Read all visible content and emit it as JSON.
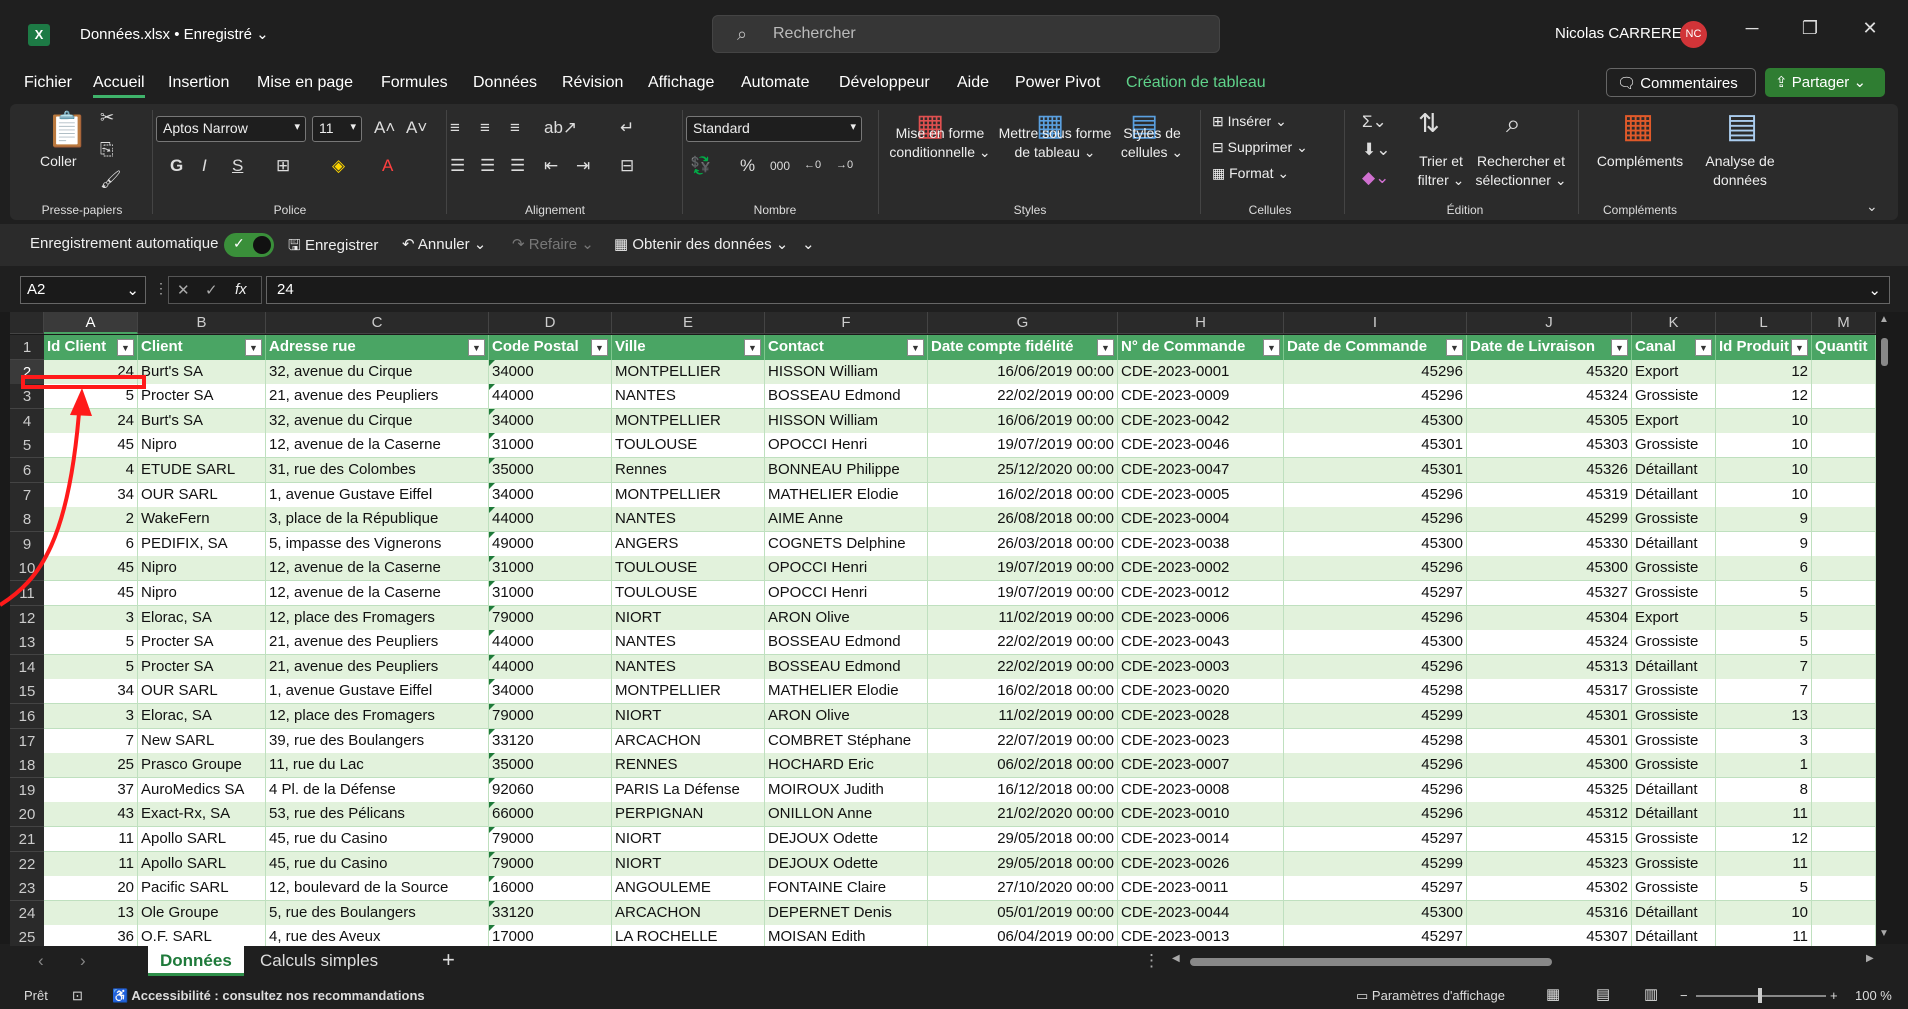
{
  "title": {
    "app_icon": "excel-logo",
    "doc": "Données.xlsx • Enregistré",
    "chev": "⌄",
    "search_placeholder": "Rechercher",
    "user": "Nicolas CARRERE",
    "initials": "NC"
  },
  "menu": [
    "Fichier",
    "Accueil",
    "Insertion",
    "Mise en page",
    "Formules",
    "Données",
    "Révision",
    "Affichage",
    "Automate",
    "Développeur",
    "Aide",
    "Power Pivot",
    "Création de tableau"
  ],
  "menu_active": "Accueil",
  "actions": {
    "comments": "Commentaires",
    "share": "Partager"
  },
  "ribbon": {
    "clipboard": {
      "paste": "Coller",
      "label": "Presse-papiers"
    },
    "font": {
      "name": "Aptos Narrow",
      "size": "11",
      "label": "Police"
    },
    "alignment": {
      "label": "Alignement"
    },
    "number": {
      "format": "Standard",
      "label": "Nombre"
    },
    "styles": {
      "cond": "Mise en forme conditionnelle ⌄",
      "table": "Mettre sous forme de tableau ⌄",
      "cell": "Styles de cellules ⌄",
      "label": "Styles"
    },
    "cells": {
      "insert": "Insérer",
      "delete": "Supprimer",
      "format": "Format",
      "label": "Cellules"
    },
    "editing": {
      "sort": "Trier et filtrer ⌄",
      "find": "Rechercher et sélectionner ⌄",
      "label": "Édition"
    },
    "addins": {
      "addins": "Compléments",
      "analyze": "Analyse de données",
      "label": "Compléments"
    }
  },
  "qat": {
    "autosave": "Enregistrement automatique",
    "save": "Enregistrer",
    "undo": "Annuler",
    "redo": "Refaire",
    "getdata": "Obtenir des données"
  },
  "formula_bar": {
    "name_box": "A2",
    "fx": "fx",
    "value": "24"
  },
  "columns": [
    {
      "letter": "A",
      "header": "Id Client"
    },
    {
      "letter": "B",
      "header": "Client"
    },
    {
      "letter": "C",
      "header": "Adresse rue"
    },
    {
      "letter": "D",
      "header": "Code Postal"
    },
    {
      "letter": "E",
      "header": "Ville"
    },
    {
      "letter": "F",
      "header": "Contact"
    },
    {
      "letter": "G",
      "header": "Date compte fidélité"
    },
    {
      "letter": "H",
      "header": "N° de Commande"
    },
    {
      "letter": "I",
      "header": "Date de Commande"
    },
    {
      "letter": "J",
      "header": "Date de Livraison"
    },
    {
      "letter": "K",
      "header": "Canal"
    },
    {
      "letter": "L",
      "header": "Id Produit"
    },
    {
      "letter": "M",
      "header": "Quantit"
    }
  ],
  "row_numbers": [
    "1",
    "2",
    "3",
    "4",
    "5",
    "6",
    "7",
    "8",
    "9",
    "10",
    "11",
    "12",
    "13",
    "14",
    "15",
    "16",
    "17",
    "18",
    "19",
    "20",
    "21",
    "22",
    "23",
    "24",
    "25"
  ],
  "rows": [
    [
      "24",
      "Burt's SA",
      "32, avenue du Cirque",
      "34000",
      "MONTPELLIER",
      "HISSON William",
      "16/06/2019 00:00",
      "CDE-2023-0001",
      "45296",
      "45320",
      "Export",
      "12"
    ],
    [
      "5",
      "Procter SA",
      "21, avenue des Peupliers",
      "44000",
      "NANTES",
      "BOSSEAU Edmond",
      "22/02/2019 00:00",
      "CDE-2023-0009",
      "45296",
      "45324",
      "Grossiste",
      "12"
    ],
    [
      "24",
      "Burt's SA",
      "32, avenue du Cirque",
      "34000",
      "MONTPELLIER",
      "HISSON William",
      "16/06/2019 00:00",
      "CDE-2023-0042",
      "45300",
      "45305",
      "Export",
      "10"
    ],
    [
      "45",
      "Nipro",
      "12, avenue de la Caserne",
      "31000",
      "TOULOUSE",
      "OPOCCI Henri",
      "19/07/2019 00:00",
      "CDE-2023-0046",
      "45301",
      "45303",
      "Grossiste",
      "10"
    ],
    [
      "4",
      "ETUDE SARL",
      "31, rue des Colombes",
      "35000",
      "Rennes",
      "BONNEAU Philippe",
      "25/12/2020 00:00",
      "CDE-2023-0047",
      "45301",
      "45326",
      "Détaillant",
      "10"
    ],
    [
      "34",
      "OUR SARL",
      "1, avenue Gustave Eiffel",
      "34000",
      "MONTPELLIER",
      "MATHELIER Elodie",
      "16/02/2018 00:00",
      "CDE-2023-0005",
      "45296",
      "45319",
      "Détaillant",
      "10"
    ],
    [
      "2",
      "WakeFern",
      "3, place de la  République",
      "44000",
      "NANTES",
      "AIME Anne",
      "26/08/2018 00:00",
      "CDE-2023-0004",
      "45296",
      "45299",
      "Grossiste",
      "9"
    ],
    [
      "6",
      "PEDIFIX, SA",
      "5, impasse des Vignerons",
      "49000",
      "ANGERS",
      "COGNETS Delphine",
      "26/03/2018 00:00",
      "CDE-2023-0038",
      "45300",
      "45330",
      "Détaillant",
      "9"
    ],
    [
      "45",
      "Nipro",
      "12, avenue de la Caserne",
      "31000",
      "TOULOUSE",
      "OPOCCI Henri",
      "19/07/2019 00:00",
      "CDE-2023-0002",
      "45296",
      "45300",
      "Grossiste",
      "6"
    ],
    [
      "45",
      "Nipro",
      "12, avenue de la Caserne",
      "31000",
      "TOULOUSE",
      "OPOCCI Henri",
      "19/07/2019 00:00",
      "CDE-2023-0012",
      "45297",
      "45327",
      "Grossiste",
      "5"
    ],
    [
      "3",
      "Elorac, SA",
      "12, place des Fromagers",
      "79000",
      "NIORT",
      "ARON Olive",
      "11/02/2019 00:00",
      "CDE-2023-0006",
      "45296",
      "45304",
      "Export",
      "5"
    ],
    [
      "5",
      "Procter SA",
      "21, avenue des Peupliers",
      "44000",
      "NANTES",
      "BOSSEAU Edmond",
      "22/02/2019 00:00",
      "CDE-2023-0043",
      "45300",
      "45324",
      "Grossiste",
      "5"
    ],
    [
      "5",
      "Procter SA",
      "21, avenue des Peupliers",
      "44000",
      "NANTES",
      "BOSSEAU Edmond",
      "22/02/2019 00:00",
      "CDE-2023-0003",
      "45296",
      "45313",
      "Détaillant",
      "7"
    ],
    [
      "34",
      "OUR SARL",
      "1, avenue Gustave Eiffel",
      "34000",
      "MONTPELLIER",
      "MATHELIER Elodie",
      "16/02/2018 00:00",
      "CDE-2023-0020",
      "45298",
      "45317",
      "Grossiste",
      "7"
    ],
    [
      "3",
      "Elorac, SA",
      "12, place des Fromagers",
      "79000",
      "NIORT",
      "ARON Olive",
      "11/02/2019 00:00",
      "CDE-2023-0028",
      "45299",
      "45301",
      "Grossiste",
      "13"
    ],
    [
      "7",
      "New SARL",
      "39, rue des Boulangers",
      "33120",
      "ARCACHON",
      "COMBRET Stéphane",
      "22/07/2019 00:00",
      "CDE-2023-0023",
      "45298",
      "45301",
      "Grossiste",
      "3"
    ],
    [
      "25",
      "Prasco Groupe",
      "11, rue du Lac",
      "35000",
      "RENNES",
      "HOCHARD Eric",
      "06/02/2018 00:00",
      "CDE-2023-0007",
      "45296",
      "45300",
      "Grossiste",
      "1"
    ],
    [
      "37",
      "AuroMedics SA",
      "4 Pl. de la Défense",
      "92060",
      "PARIS La Défense",
      "MOIROUX Judith",
      "16/12/2018 00:00",
      "CDE-2023-0008",
      "45296",
      "45325",
      "Détaillant",
      "8"
    ],
    [
      "43",
      "Exact-Rx, SA",
      "53, rue des Pélicans",
      "66000",
      "PERPIGNAN",
      "ONILLON Anne",
      "21/02/2020 00:00",
      "CDE-2023-0010",
      "45296",
      "45312",
      "Détaillant",
      "11"
    ],
    [
      "11",
      "Apollo SARL",
      "45, rue du Casino",
      "79000",
      "NIORT",
      "DEJOUX Odette",
      "29/05/2018 00:00",
      "CDE-2023-0014",
      "45297",
      "45315",
      "Grossiste",
      "12"
    ],
    [
      "11",
      "Apollo SARL",
      "45, rue du Casino",
      "79000",
      "NIORT",
      "DEJOUX Odette",
      "29/05/2018 00:00",
      "CDE-2023-0026",
      "45299",
      "45323",
      "Grossiste",
      "11"
    ],
    [
      "20",
      "Pacific SARL",
      "12, boulevard de la Source",
      "16000",
      "ANGOULEME",
      "FONTAINE Claire",
      "27/10/2020 00:00",
      "CDE-2023-0011",
      "45297",
      "45302",
      "Grossiste",
      "5"
    ],
    [
      "13",
      "Ole Groupe",
      "5, rue des Boulangers",
      "33120",
      "ARCACHON",
      "DEPERNET Denis",
      "05/01/2019 00:00",
      "CDE-2023-0044",
      "45300",
      "45316",
      "Détaillant",
      "10"
    ],
    [
      "36",
      "O.F. SARL",
      "4, rue des Aveux",
      "17000",
      "LA ROCHELLE",
      "MOISAN Edith",
      "06/04/2019 00:00",
      "CDE-2023-0013",
      "45297",
      "45307",
      "Détaillant",
      "11"
    ]
  ],
  "sheets": [
    "Données",
    "Calculs simples"
  ],
  "active_sheet": "Données",
  "status": {
    "ready": "Prêt",
    "accessibility": "Accessibilité : consultez nos recommandations",
    "display": "Paramètres d'affichage",
    "zoom": "100 %"
  },
  "colors": {
    "header_green": "#4aa564",
    "band_light": "#e2f2dc",
    "band_white": "#ffffff",
    "share_green": "#2f7d32",
    "selection_red": "#ff1a1a"
  }
}
